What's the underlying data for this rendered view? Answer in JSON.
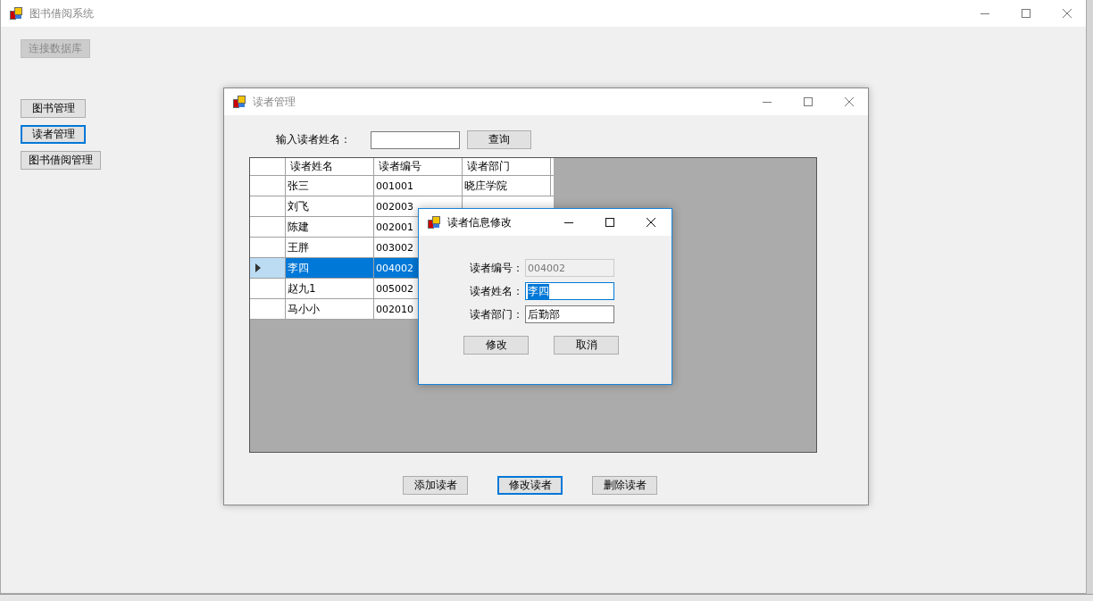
{
  "main_window": {
    "title": "图书借阅系统",
    "connect_button": {
      "label": "连接数据库",
      "disabled": true
    },
    "nav_buttons": [
      {
        "label": "图书管理",
        "focused": false
      },
      {
        "label": "读者管理",
        "focused": true
      },
      {
        "label": "图书借阅管理",
        "focused": false
      }
    ]
  },
  "reader_window": {
    "title": "读者管理",
    "search_label": "输入读者姓名：",
    "search_button": "查询",
    "table": {
      "columns": [
        "读者姓名",
        "读者编号",
        "读者部门"
      ],
      "rows": [
        {
          "name": "张三",
          "code": "001001",
          "dept": "晓庄学院",
          "selected": false
        },
        {
          "name": "刘飞",
          "code": "002003",
          "selected": false
        },
        {
          "name": "陈建",
          "code": "002001",
          "selected": false
        },
        {
          "name": "王胖",
          "code": "003002",
          "selected": false
        },
        {
          "name": "李四",
          "code": "004002",
          "selected": true
        },
        {
          "name": "赵九1",
          "code": "005002",
          "selected": false
        },
        {
          "name": "马小小",
          "code": "002010",
          "selected": false
        }
      ]
    },
    "buttons": [
      {
        "label": "添加读者",
        "focused": false
      },
      {
        "label": "修改读者",
        "focused": true
      },
      {
        "label": "删除读者",
        "focused": false
      }
    ]
  },
  "edit_dialog": {
    "title": "读者信息修改",
    "fields": [
      {
        "label": "读者编号：",
        "value": "004002",
        "disabled": true,
        "focused": false
      },
      {
        "label": "读者姓名：",
        "value": "李四",
        "disabled": false,
        "focused": true
      },
      {
        "label": "读者部门：",
        "value": "后勤部",
        "disabled": false,
        "focused": false
      }
    ],
    "buttons": [
      "修改",
      "取消"
    ]
  }
}
